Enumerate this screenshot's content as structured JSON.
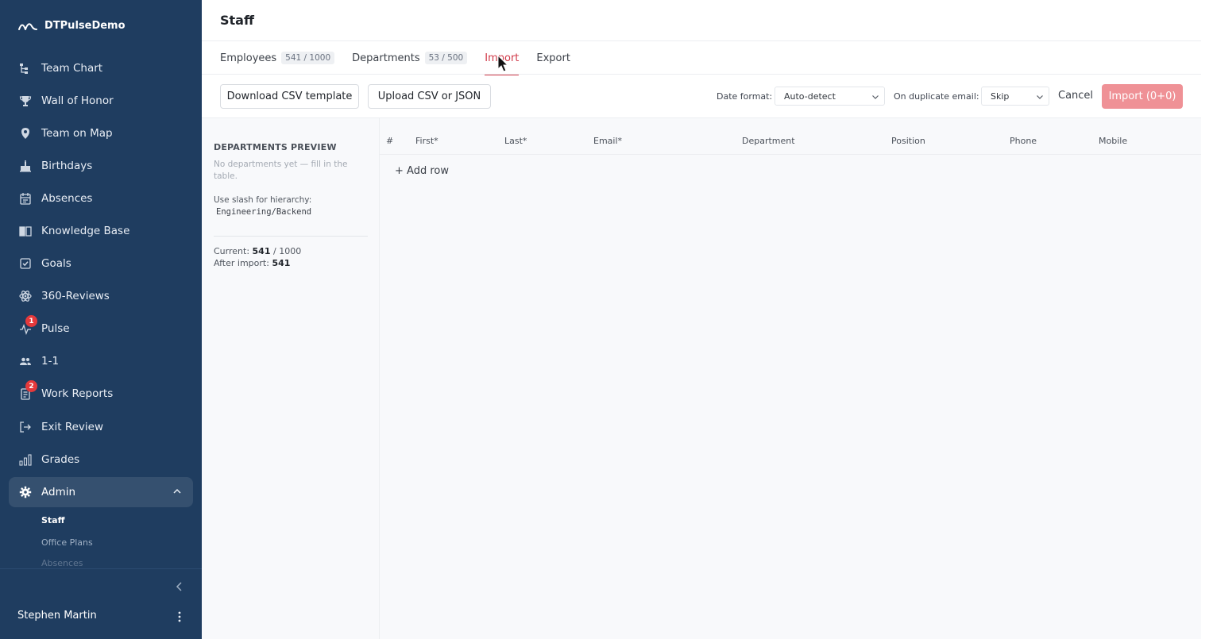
{
  "app": {
    "name": "DTPulseDemo"
  },
  "sidebar": {
    "items": [
      {
        "label": "Team Chart",
        "icon": "org-chart-icon"
      },
      {
        "label": "Wall of Honor",
        "icon": "trophy-icon"
      },
      {
        "label": "Team on Map",
        "icon": "map-pin-icon"
      },
      {
        "label": "Birthdays",
        "icon": "cake-icon"
      },
      {
        "label": "Absences",
        "icon": "calendar-icon"
      },
      {
        "label": "Knowledge Base",
        "icon": "book-icon"
      },
      {
        "label": "Goals",
        "icon": "checkbox-icon"
      },
      {
        "label": "360-Reviews",
        "icon": "atom-icon"
      },
      {
        "label": "Pulse",
        "icon": "pulse-icon",
        "badge": "1"
      },
      {
        "label": "1-1",
        "icon": "people-icon"
      },
      {
        "label": "Work Reports",
        "icon": "report-icon",
        "badge": "2"
      },
      {
        "label": "Exit Review",
        "icon": "exit-icon"
      },
      {
        "label": "Grades",
        "icon": "bars-icon"
      }
    ],
    "admin": {
      "label": "Admin",
      "sub": [
        "Staff",
        "Office Plans",
        "Absences"
      ]
    },
    "user_name": "Stephen Martin"
  },
  "page": {
    "title": "Staff"
  },
  "tabs": [
    {
      "label": "Employees",
      "count": "541 / 1000"
    },
    {
      "label": "Departments",
      "count": "53 / 500"
    },
    {
      "label": "Import",
      "count": null
    },
    {
      "label": "Export",
      "count": null
    }
  ],
  "toolbar": {
    "download_label": "Download CSV template",
    "upload_label": "Upload CSV or JSON",
    "date_format_label": "Date format:",
    "date_format_value": "Auto-detect",
    "dup_label": "On duplicate email:",
    "dup_value": "Skip",
    "cancel_label": "Cancel",
    "import_label": "Import (0+0)"
  },
  "preview": {
    "title": "DEPARTMENTS PREVIEW",
    "empty": "No departments yet — fill in the table.",
    "hint": "Use slash for hierarchy:",
    "code": "Engineering/Backend",
    "current_label": "Current:",
    "current_value": "541",
    "current_max": "/ 1000",
    "after_label": "After import:",
    "after_value": "541"
  },
  "grid": {
    "columns": [
      "#",
      "First*",
      "Last*",
      "Email*",
      "Department",
      "Position",
      "Phone",
      "Mobile"
    ],
    "add_row": "+ Add row"
  },
  "colors": {
    "sidebar_bg": "#1f3d60",
    "accent": "#d13b4a",
    "import_btn": "#ef9196"
  }
}
